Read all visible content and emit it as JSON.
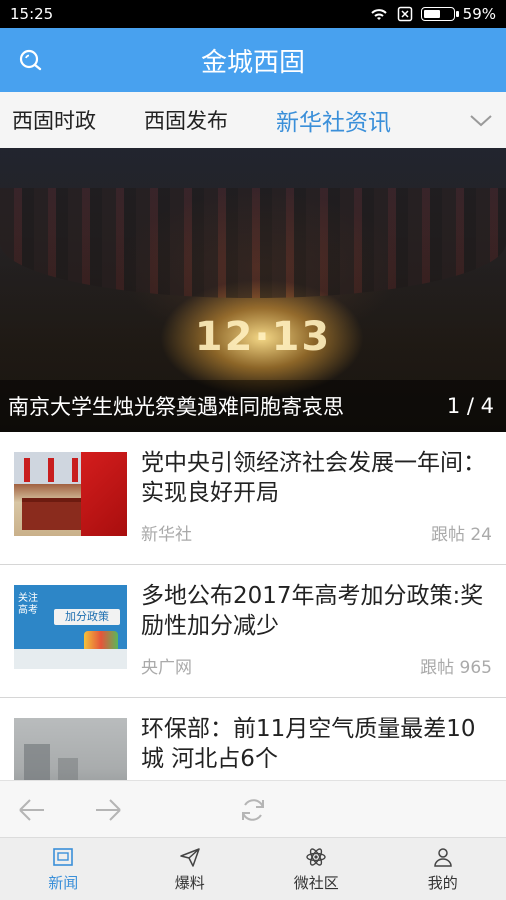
{
  "status_bar": {
    "time": "15:25",
    "battery": "59%",
    "battery_level": 0.59
  },
  "header": {
    "title": "金城西固",
    "search_icon": "search-icon"
  },
  "tabs": [
    {
      "label": "西固时政",
      "active": false
    },
    {
      "label": "西固发布",
      "active": false
    },
    {
      "label": "新华社资讯",
      "active": true
    }
  ],
  "banner": {
    "caption": "南京大学生烛光祭奠遇难同胞寄哀思",
    "counter": "1 / 4",
    "candle_text": "12·13"
  },
  "news": [
    {
      "headline": "党中央引领经济社会发展一年间：实现良好开局",
      "source": "新华社",
      "replies": "跟帖 24"
    },
    {
      "headline": "多地公布2017年高考加分政策:奖励性加分减少",
      "source": "央广网",
      "replies": "跟帖 965",
      "thumb_text_1": "关注",
      "thumb_text_2": "高考",
      "thumb_text_3": "加分政策"
    },
    {
      "headline": "环保部：前11月空气质量最差10城 河北占6个",
      "source": "",
      "replies": ""
    }
  ],
  "browser_bar": {
    "back_icon": "arrow-left-icon",
    "forward_icon": "arrow-right-icon",
    "refresh_icon": "refresh-icon"
  },
  "bottom_nav": [
    {
      "label": "新闻",
      "icon": "news-icon",
      "active": true
    },
    {
      "label": "爆料",
      "icon": "send-icon",
      "active": false
    },
    {
      "label": "微社区",
      "icon": "atom-icon",
      "active": false
    },
    {
      "label": "我的",
      "icon": "person-icon",
      "active": false
    }
  ],
  "colors": {
    "primary": "#48a1ef",
    "active": "#3a8fd9"
  }
}
